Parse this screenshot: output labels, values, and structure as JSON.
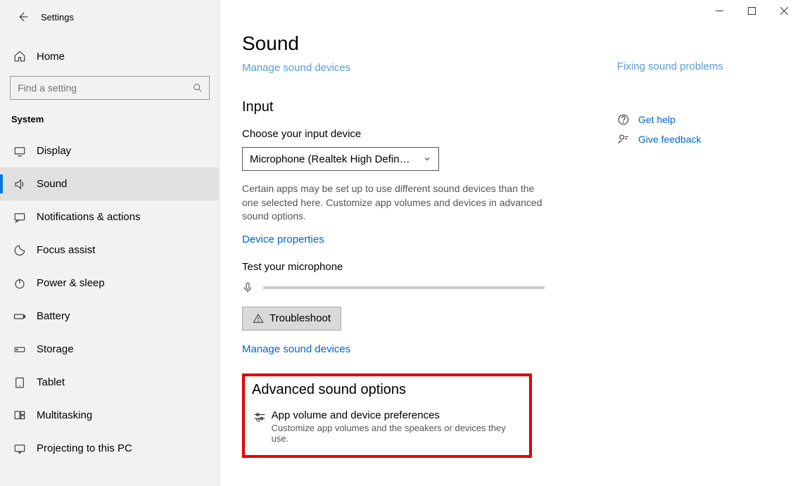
{
  "app_title": "Settings",
  "home_label": "Home",
  "search_placeholder": "Find a setting",
  "category_label": "System",
  "nav": [
    {
      "label": "Display"
    },
    {
      "label": "Sound",
      "selected": true
    },
    {
      "label": "Notifications & actions"
    },
    {
      "label": "Focus assist"
    },
    {
      "label": "Power & sleep"
    },
    {
      "label": "Battery"
    },
    {
      "label": "Storage"
    },
    {
      "label": "Tablet"
    },
    {
      "label": "Multitasking"
    },
    {
      "label": "Projecting to this PC"
    }
  ],
  "page_title": "Sound",
  "truncated_top_link": "Manage sound devices",
  "input_section": "Input",
  "choose_input": "Choose your input device",
  "input_device": "Microphone (Realtek High Definitio...",
  "input_desc": "Certain apps may be set up to use different sound devices than the one selected here. Customize app volumes and devices in advanced sound options.",
  "device_props": "Device properties",
  "test_mic": "Test your microphone",
  "troubleshoot": "Troubleshoot",
  "manage_devices": "Manage sound devices",
  "adv_h": "Advanced sound options",
  "adv_item_title": "App volume and device preferences",
  "adv_item_desc": "Customize app volumes and the speakers or devices they use.",
  "right_trunc": "Fixing sound problems",
  "help": "Get help",
  "feedback": "Give feedback",
  "icons": {
    "back": "←",
    "chevron": "˅"
  }
}
